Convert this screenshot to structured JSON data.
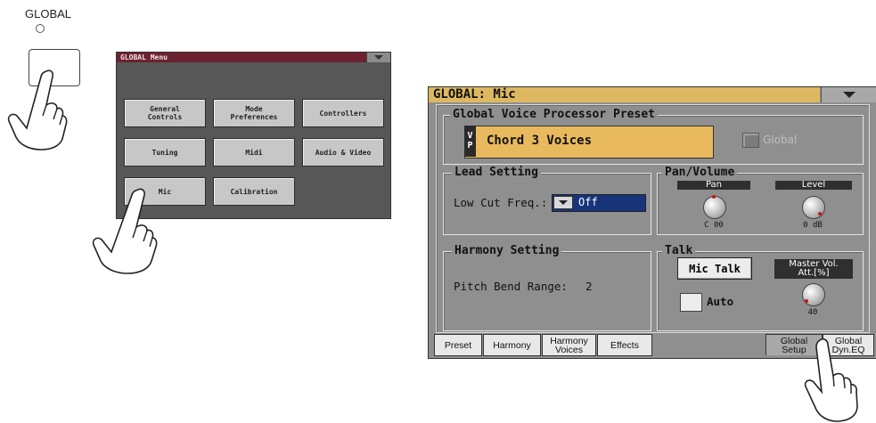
{
  "hardware": {
    "global_label": "GLOBAL"
  },
  "global_menu": {
    "title": "GLOBAL Menu",
    "buttons": [
      "General\nControls",
      "Mode\nPreferences",
      "Controllers",
      "Tuning",
      "Midi",
      "Audio & Video",
      "Mic",
      "Calibration"
    ]
  },
  "mic_page": {
    "title": "GLOBAL: Mic",
    "preset_section": "Global Voice Processor Preset",
    "vp_badge": "V\nP",
    "preset_name": "Chord 3 Voices",
    "global_checkbox_label": "Global",
    "lead": {
      "title": "Lead Setting",
      "low_cut_label": "Low Cut Freq.:",
      "low_cut_value": "Off"
    },
    "pan_volume": {
      "title": "Pan/Volume",
      "pan_label": "Pan",
      "pan_value": "C 00",
      "level_label": "Level",
      "level_value": "0 dB"
    },
    "harmony": {
      "title": "Harmony Setting",
      "pitch_bend_label": "Pitch Bend Range:",
      "pitch_bend_value": "2"
    },
    "talk": {
      "title": "Talk",
      "mic_talk_label": "Mic Talk",
      "auto_label": "Auto",
      "master_att_label": "Master Vol.\nAtt.[%]",
      "master_att_value": "40"
    },
    "tabs": [
      "Preset",
      "Harmony",
      "Harmony\nVoices",
      "Effects",
      "Global\nSetup",
      "Global\nDyn.EQ"
    ],
    "active_tab": "Global\nSetup"
  },
  "colors": {
    "menu_title_bg": "#6d2230",
    "mic_title_bg": "#ddb860",
    "preset_field": "#e9b95e",
    "select_bg": "#17347a"
  }
}
